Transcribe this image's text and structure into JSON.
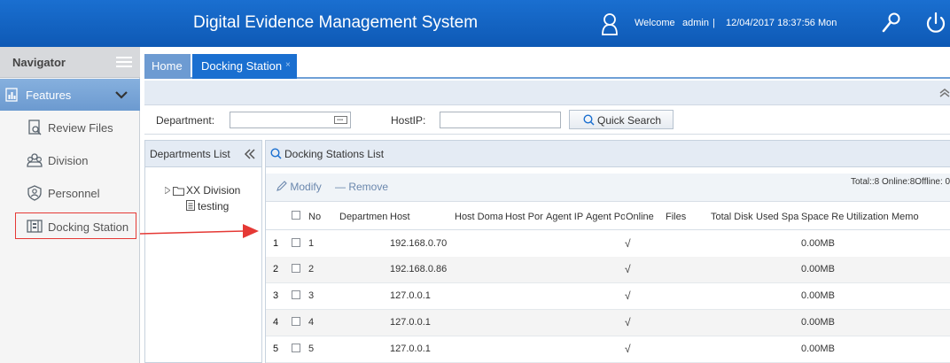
{
  "header": {
    "title": "Digital Evidence Management System",
    "welcome": "Welcome",
    "username": "admin",
    "separator": "|",
    "datetime": "12/04/2017 18:37:56 Mon"
  },
  "sidebar": {
    "title": "Navigator",
    "section": "Features",
    "items": [
      {
        "label": "Review Files",
        "icon": "review-files-icon"
      },
      {
        "label": "Division",
        "icon": "division-icon"
      },
      {
        "label": "Personnel",
        "icon": "personnel-icon"
      },
      {
        "label": "Docking Station",
        "icon": "docking-station-icon"
      }
    ]
  },
  "tabs": [
    {
      "label": "Home"
    },
    {
      "label": "Docking Station"
    }
  ],
  "tab_close": "×",
  "search": {
    "department_label": "Department:",
    "department_value": "",
    "host_label": "HostIP:",
    "host_value": "",
    "button": "Quick Search"
  },
  "departments": {
    "title": "Departments List",
    "root": "XX Division",
    "child": "testing"
  },
  "list": {
    "title": "Docking Stations List",
    "modify": "Modify",
    "remove": "— Remove",
    "totals": "Total::8 Online:8Offline: 0",
    "columns": [
      "No",
      "Departmen",
      "Host",
      "Host Doma",
      "Host Por",
      "Agent IP",
      "Agent Po",
      "Online",
      "Files",
      "Total Disk",
      "Used Spa",
      "Space Re",
      "Utilization",
      "Memo"
    ],
    "rows": [
      {
        "rn": "1",
        "no": "1",
        "host": "192.168.0.70",
        "online": "√",
        "space": "0.00MB"
      },
      {
        "rn": "2",
        "no": "2",
        "host": "192.168.0.86",
        "online": "√",
        "space": "0.00MB"
      },
      {
        "rn": "3",
        "no": "3",
        "host": "127.0.0.1",
        "online": "√",
        "space": "0.00MB"
      },
      {
        "rn": "4",
        "no": "4",
        "host": "127.0.0.1",
        "online": "√",
        "space": "0.00MB"
      },
      {
        "rn": "5",
        "no": "5",
        "host": "127.0.0.1",
        "online": "√",
        "space": "0.00MB"
      }
    ]
  },
  "colors": {
    "header": "#1565c0",
    "accent": "#1a6fd0",
    "annotation": "#e53935"
  }
}
